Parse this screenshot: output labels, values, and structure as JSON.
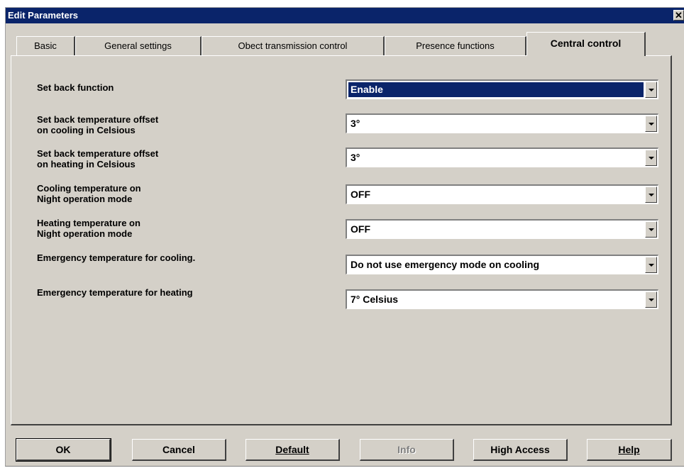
{
  "window": {
    "title": "Edit Parameters",
    "close_glyph": "✕"
  },
  "tabs": [
    {
      "label": "Basic",
      "active": false
    },
    {
      "label": "General settings",
      "active": false
    },
    {
      "label": "Obect transmission control",
      "active": false
    },
    {
      "label": "Presence functions",
      "active": false
    },
    {
      "label": "Central control",
      "active": true
    }
  ],
  "parameters": [
    {
      "label_lines": [
        "Set back function"
      ],
      "value": "Enable",
      "selected": true
    },
    {
      "label_lines": [
        "Set back temperature offset",
        "on cooling in Celsious"
      ],
      "value": "3°"
    },
    {
      "label_lines": [
        "Set back temperature offset",
        "on heating in Celsious"
      ],
      "value": "3°"
    },
    {
      "label_lines": [
        "Cooling temperature on",
        "Night operation mode"
      ],
      "value": "OFF"
    },
    {
      "label_lines": [
        "Heating temperature on",
        "Night operation mode"
      ],
      "value": "OFF"
    },
    {
      "label_lines": [
        "Emergency temperature for cooling."
      ],
      "value": "Do not use emergency mode on cooling"
    },
    {
      "label_lines": [
        "Emergency temperature for heating"
      ],
      "value": "7° Celsius"
    }
  ],
  "buttons": {
    "ok": "OK",
    "cancel": "Cancel",
    "default": "Default",
    "info": "Info",
    "high_access": "High Access",
    "help": "Help"
  },
  "colors": {
    "titlebar": "#0a246a",
    "face": "#d4d0c8",
    "selection": "#0a246a"
  }
}
